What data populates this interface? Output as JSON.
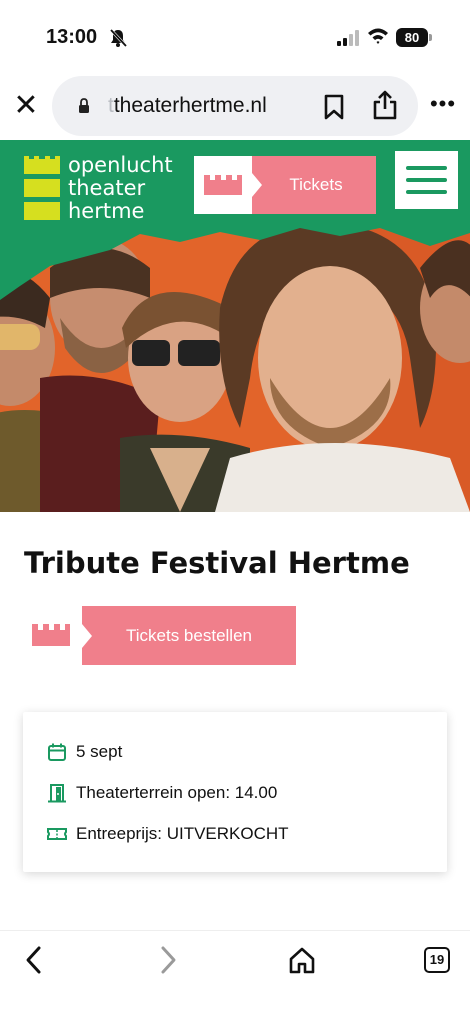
{
  "status_bar": {
    "time": "13:00",
    "battery": "80",
    "icons": [
      "bell-slash-icon",
      "signal-icon",
      "wifi-icon",
      "battery-icon"
    ]
  },
  "browser": {
    "url_faded": "t",
    "url_main": "theaterhertme.nl",
    "icons": [
      "close-icon",
      "lock-icon",
      "bookmark-icon",
      "share-icon",
      "more-icon"
    ]
  },
  "site_header": {
    "logo_lines": [
      "openlucht",
      "theater",
      "hertme"
    ],
    "tickets_label": "Tickets",
    "menu_icon": "hamburger-icon"
  },
  "event": {
    "title": "Tribute Festival Hertme",
    "order_button": "Tickets bestellen"
  },
  "info": {
    "date": "5 sept",
    "gate": "Theaterterrein open: 14.00",
    "price": "Entreeprijs: UITVERKOCHT"
  },
  "bottom_nav": {
    "tab_count": "19",
    "icons": [
      "back-icon",
      "forward-icon",
      "home-icon",
      "tabs-icon"
    ]
  },
  "colors": {
    "brand_green": "#1a9960",
    "brand_pink": "#f07f8b",
    "logo_yellow": "#d6df1f",
    "hero_orange": "#e2642a"
  }
}
